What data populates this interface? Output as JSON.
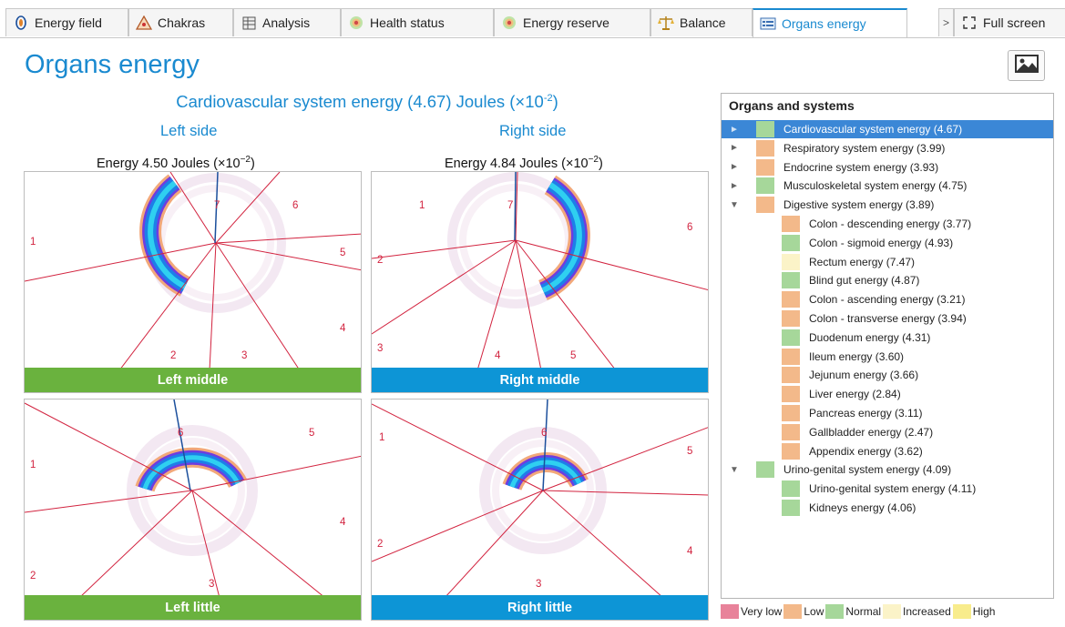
{
  "tabs": [
    {
      "label": "Energy field",
      "icon": "energy-field-icon"
    },
    {
      "label": "Chakras",
      "icon": "chakras-icon"
    },
    {
      "label": "Analysis",
      "icon": "analysis-icon"
    },
    {
      "label": "Health status",
      "icon": "health-status-icon"
    },
    {
      "label": "Energy reserve",
      "icon": "energy-reserve-icon"
    },
    {
      "label": "Balance",
      "icon": "balance-icon"
    },
    {
      "label": "Organs energy",
      "icon": "organs-energy-icon",
      "active": true
    },
    {
      "label": "Full screen",
      "icon": "full-screen-icon"
    }
  ],
  "tab_scroll_glyph": ">",
  "page_title": "Organs energy",
  "system_title": "Cardiovascular system energy (4.67) Joules (×10",
  "system_title_exp": "-2",
  "system_title_end": ")",
  "left_side_label": "Left side",
  "right_side_label": "Right side",
  "left_energy": "Energy 4.50 Joules (×10",
  "right_energy": "Energy 4.84 Joules (×10",
  "energy_exp": "−2",
  "energy_end": ")",
  "panels": [
    {
      "caption": "Left middle",
      "caption_color": "#6ab23e"
    },
    {
      "caption": "Right middle",
      "caption_color": "#0d95d6"
    },
    {
      "caption": "Left little",
      "caption_color": "#6ab23e"
    },
    {
      "caption": "Right little",
      "caption_color": "#0d95d6"
    }
  ],
  "sector_numbers": {
    "left_middle": [
      "1",
      "2",
      "3",
      "4",
      "5",
      "6",
      "7"
    ],
    "right_middle": [
      "1",
      "2",
      "3",
      "4",
      "5",
      "6",
      "7"
    ],
    "left_little": [
      "1",
      "2",
      "3",
      "4",
      "5",
      "6"
    ],
    "right_little": [
      "1",
      "2",
      "3",
      "4",
      "5",
      "6"
    ]
  },
  "organs": {
    "header": "Organs and systems",
    "items": [
      {
        "label": "Cardiovascular system energy (4.67)",
        "level": "Normal",
        "depth": 0,
        "arrow": "►",
        "selected": true
      },
      {
        "label": "Respiratory system energy (3.99)",
        "level": "Low",
        "depth": 0,
        "arrow": "►"
      },
      {
        "label": "Endocrine system energy (3.93)",
        "level": "Low",
        "depth": 0,
        "arrow": "►"
      },
      {
        "label": "Musculoskeletal system energy (4.75)",
        "level": "Normal",
        "depth": 0,
        "arrow": "►"
      },
      {
        "label": "Digestive system energy (3.89)",
        "level": "Low",
        "depth": 0,
        "arrow": "▼"
      },
      {
        "label": "Colon - descending energy (3.77)",
        "level": "Low",
        "depth": 1
      },
      {
        "label": "Colon - sigmoid energy (4.93)",
        "level": "Normal",
        "depth": 1
      },
      {
        "label": "Rectum energy (7.47)",
        "level": "Increased",
        "depth": 1
      },
      {
        "label": "Blind gut energy (4.87)",
        "level": "Normal",
        "depth": 1
      },
      {
        "label": "Colon - ascending energy (3.21)",
        "level": "Low",
        "depth": 1
      },
      {
        "label": "Colon - transverse energy (3.94)",
        "level": "Low",
        "depth": 1
      },
      {
        "label": "Duodenum energy (4.31)",
        "level": "Normal",
        "depth": 1
      },
      {
        "label": "Ileum energy (3.60)",
        "level": "Low",
        "depth": 1
      },
      {
        "label": "Jejunum energy (3.66)",
        "level": "Low",
        "depth": 1
      },
      {
        "label": "Liver energy (2.84)",
        "level": "Low",
        "depth": 1
      },
      {
        "label": "Pancreas energy (3.11)",
        "level": "Low",
        "depth": 1
      },
      {
        "label": "Gallbladder energy (2.47)",
        "level": "Low",
        "depth": 1
      },
      {
        "label": "Appendix energy (3.62)",
        "level": "Low",
        "depth": 1
      },
      {
        "label": "Urino-genital system energy (4.09)",
        "level": "Normal",
        "depth": 0,
        "arrow": "▼"
      },
      {
        "label": "Urino-genital system energy (4.11)",
        "level": "Normal",
        "depth": 1
      },
      {
        "label": "Kidneys energy (4.06)",
        "level": "Normal",
        "depth": 1
      }
    ]
  },
  "legend": [
    {
      "label": "Very low",
      "color": "#e8829a"
    },
    {
      "label": "Low",
      "color": "#f3b98a"
    },
    {
      "label": "Normal",
      "color": "#a6d79a"
    },
    {
      "label": "Increased",
      "color": "#fbf3c8"
    },
    {
      "label": "High",
      "color": "#f8ec8c"
    }
  ],
  "colors": {
    "accent": "#1a8ad0",
    "selected_row": "#3b87d6",
    "sector_lines": "#d2233f",
    "axis_line": "#1b4f9c"
  }
}
